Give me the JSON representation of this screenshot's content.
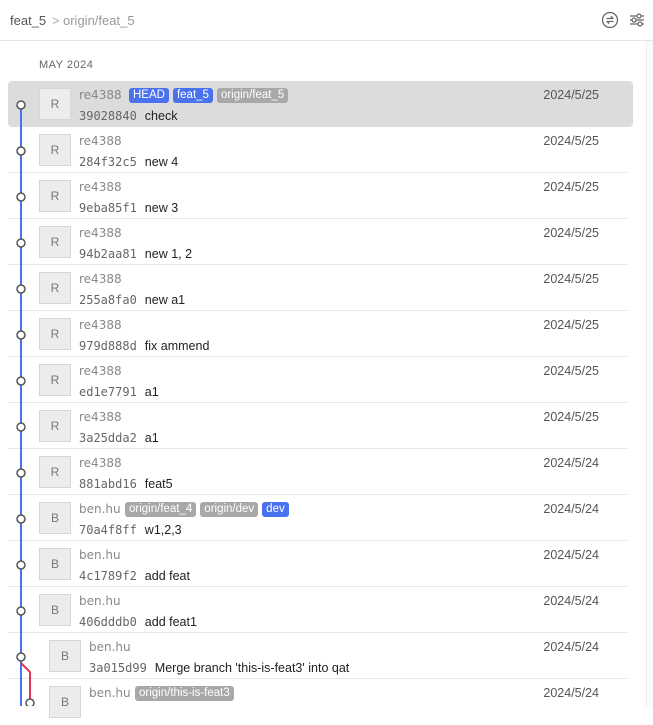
{
  "header": {
    "branch": "feat_5",
    "separator": ">",
    "upstream": "origin/feat_5",
    "icons": [
      "sync-icon",
      "filter-settings-icon"
    ]
  },
  "month_label": "MAY 2024",
  "colors": {
    "blue_badge": "#4a72ee",
    "gray_badge": "#a8a8a8",
    "graph_main": "#4a72ee",
    "graph_merge": "#e0334f",
    "selected_row": "#dcdcdc"
  },
  "commits": [
    {
      "author": "re4388",
      "avatar": "R",
      "sha": "39028840",
      "message": "check",
      "date": "2024/5/25",
      "tags": [
        {
          "text": "HEAD",
          "color": "blue"
        },
        {
          "text": "feat_5",
          "color": "blue"
        },
        {
          "text": "origin/feat_5",
          "color": "gray"
        }
      ],
      "selected": true
    },
    {
      "author": "re4388",
      "avatar": "R",
      "sha": "284f32c5",
      "message": "new 4",
      "date": "2024/5/25",
      "tags": []
    },
    {
      "author": "re4388",
      "avatar": "R",
      "sha": "9eba85f1",
      "message": "new 3",
      "date": "2024/5/25",
      "tags": []
    },
    {
      "author": "re4388",
      "avatar": "R",
      "sha": "94b2aa81",
      "message": "new 1, 2",
      "date": "2024/5/25",
      "tags": []
    },
    {
      "author": "re4388",
      "avatar": "R",
      "sha": "255a8fa0",
      "message": "new a1",
      "date": "2024/5/25",
      "tags": []
    },
    {
      "author": "re4388",
      "avatar": "R",
      "sha": "979d888d",
      "message": "fix ammend",
      "date": "2024/5/25",
      "tags": []
    },
    {
      "author": "re4388",
      "avatar": "R",
      "sha": "ed1e7791",
      "message": "a1",
      "date": "2024/5/25",
      "tags": []
    },
    {
      "author": "re4388",
      "avatar": "R",
      "sha": "3a25dda2",
      "message": "a1",
      "date": "2024/5/25",
      "tags": []
    },
    {
      "author": "re4388",
      "avatar": "R",
      "sha": "881abd16",
      "message": "feat5",
      "date": "2024/5/24",
      "tags": []
    },
    {
      "author": "ben.hu",
      "avatar": "B",
      "sha": "70a4f8ff",
      "message": "w1,2,3",
      "date": "2024/5/24",
      "tags": [
        {
          "text": "origin/feat_4",
          "color": "gray"
        },
        {
          "text": "origin/dev",
          "color": "gray"
        },
        {
          "text": "dev",
          "color": "blue"
        }
      ]
    },
    {
      "author": "ben.hu",
      "avatar": "B",
      "sha": "4c1789f2",
      "message": "add feat",
      "date": "2024/5/24",
      "tags": []
    },
    {
      "author": "ben.hu",
      "avatar": "B",
      "sha": "406dddb0",
      "message": "add feat1",
      "date": "2024/5/24",
      "tags": []
    },
    {
      "author": "ben.hu",
      "avatar": "B",
      "sha": "3a015d99",
      "message": "Merge branch 'this-is-feat3' into qat",
      "date": "2024/5/24",
      "tags": []
    },
    {
      "author": "ben.hu",
      "avatar": "B",
      "sha": "",
      "message": "",
      "date": "2024/5/24",
      "tags": [
        {
          "text": "origin/this-is-feat3",
          "color": "gray"
        }
      ]
    }
  ]
}
